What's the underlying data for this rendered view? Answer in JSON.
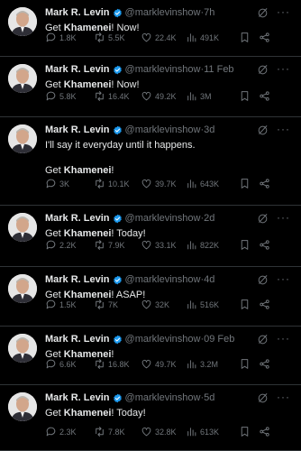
{
  "colors": {
    "background": "#000000",
    "text": "#e7e9ea",
    "muted": "#71767b",
    "verified": "#1d9bf0",
    "divider": "#2f3336"
  },
  "icons": {
    "reply": "reply-icon",
    "retweet": "retweet-icon",
    "like": "heart-icon",
    "views": "views-icon",
    "bookmark": "bookmark-icon",
    "share": "share-icon",
    "grok": "grok-icon",
    "more": "more-icon"
  },
  "tweets": [
    {
      "name": "Mark R. Levin",
      "handle": "@marklevinshow",
      "dot": "·",
      "time": "7h",
      "more": "···",
      "text_pre": "Get ",
      "text_bold": "Khamenei",
      "text_post": "!  Now!",
      "replies": "1.8K",
      "retweets": "5.5K",
      "likes": "22.4K",
      "views": "491K"
    },
    {
      "name": "Mark R. Levin",
      "handle": "@marklevinshow",
      "dot": "·",
      "time": "11 Feb",
      "more": "···",
      "text_pre": "Get ",
      "text_bold": "Khamenei",
      "text_post": "!  Now!",
      "replies": "5.8K",
      "retweets": "16.4K",
      "likes": "49.2K",
      "views": "3M"
    },
    {
      "name": "Mark R. Levin",
      "handle": "@marklevinshow",
      "dot": "·",
      "time": "3d",
      "more": "···",
      "text_pre": "I'll say it everyday until it happens.\n\nGet ",
      "text_bold": "Khamenei",
      "text_post": "!",
      "replies": "3K",
      "retweets": "10.1K",
      "likes": "39.7K",
      "views": "643K"
    },
    {
      "name": "Mark R. Levin",
      "handle": "@marklevinshow",
      "dot": "·",
      "time": "2d",
      "more": "···",
      "text_pre": "Get ",
      "text_bold": "Khamenei",
      "text_post": "!  Today!",
      "replies": "2.2K",
      "retweets": "7.9K",
      "likes": "33.1K",
      "views": "822K"
    },
    {
      "name": "Mark R. Levin",
      "handle": "@marklevinshow",
      "dot": "·",
      "time": "4d",
      "more": "···",
      "text_pre": "Get ",
      "text_bold": "Khamenei",
      "text_post": "!  ASAP!",
      "replies": "1.5K",
      "retweets": "7K",
      "likes": "32K",
      "views": "516K"
    },
    {
      "name": "Mark R. Levin",
      "handle": "@marklevinshow",
      "dot": "·",
      "time": "09 Feb",
      "more": "···",
      "text_pre": "Get ",
      "text_bold": "Khamenei",
      "text_post": "!",
      "replies": "6.6K",
      "retweets": "16.8K",
      "likes": "49.7K",
      "views": "3.2M"
    },
    {
      "name": "Mark R. Levin",
      "handle": "@marklevinshow",
      "dot": "·",
      "time": "5d",
      "more": "···",
      "text_pre": "Get ",
      "text_bold": "Khamenei",
      "text_post": "! Today!",
      "replies": "2.3K",
      "retweets": "7.8K",
      "likes": "32.8K",
      "views": "613K"
    }
  ]
}
